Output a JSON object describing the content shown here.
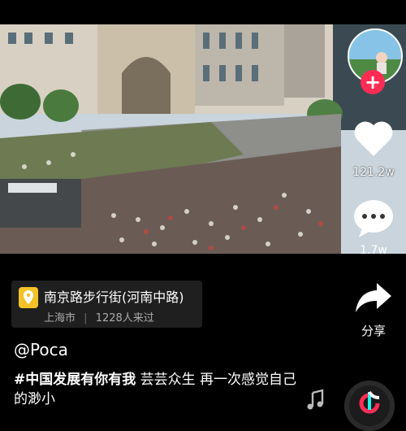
{
  "video": {
    "scene": "street-crowd"
  },
  "rail": {
    "like_count": "121.2w",
    "comment_count": "1.7w",
    "share_label": "分享",
    "follow_symbol": "+"
  },
  "location": {
    "name": "南京路步行街(河南中路)",
    "city": "上海市",
    "visitors": "1228人来过",
    "separator": "|"
  },
  "post": {
    "username": "@Poca",
    "hashtag": "#中国发展有你有我",
    "caption": " 芸芸众生 再一次感觉自己的渺小"
  },
  "colors": {
    "accent": "#fe2c55",
    "pin": "#f3c228"
  },
  "icons": [
    "heart-icon",
    "comment-icon",
    "share-icon",
    "location-pin-icon",
    "music-note-icon",
    "music-disc-icon"
  ]
}
